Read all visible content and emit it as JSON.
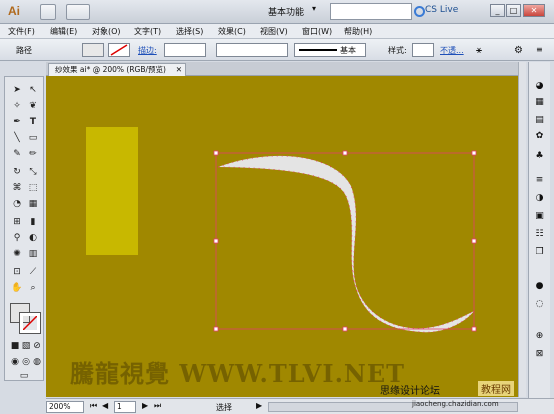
{
  "app": {
    "logo_text": "Ai",
    "workspace": "基本功能",
    "cs_live": "CS Live"
  },
  "menu": [
    "文件(F)",
    "编辑(E)",
    "对象(O)",
    "文字(T)",
    "选择(S)",
    "效果(C)",
    "视图(V)",
    "窗口(W)",
    "帮助(H)"
  ],
  "control": {
    "object_type": "路径",
    "stroke_label": "描边:",
    "stroke_profile": "基本",
    "style_label": "样式:",
    "opacity_label": "不透..."
  },
  "document": {
    "tab_title": "纱效果 ai* @ 200% (RGB/预览)"
  },
  "status": {
    "zoom": "200%",
    "page": "1",
    "tool": "选择"
  },
  "watermark": {
    "main": "騰龍視覺 WWW.TLVI.NET",
    "site_cn": "思缘设计论坛",
    "badge": "教程网",
    "domain": "jiaocheng.chazidian.com"
  },
  "colors": {
    "canvas": "#a08800",
    "rect": "#c8b800",
    "shape": "#e4e4e4",
    "selection": "#e0406a"
  }
}
